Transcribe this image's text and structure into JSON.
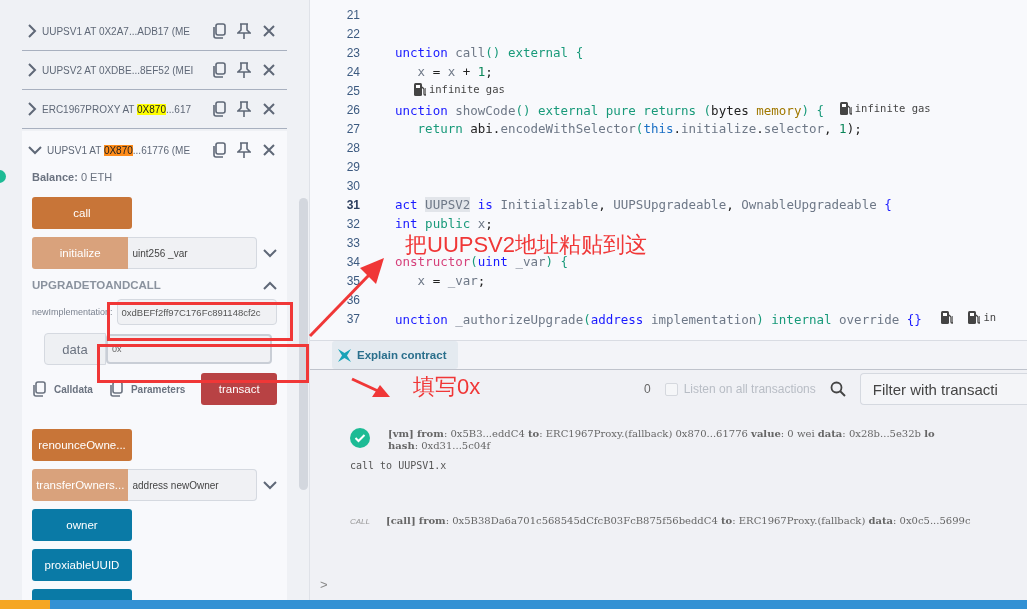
{
  "instances": [
    {
      "expanded": false,
      "title_parts": [
        {
          "text": "UUPSV1 AT 0X2A7...ADB17 (ME"
        }
      ]
    },
    {
      "expanded": false,
      "title_parts": [
        {
          "text": "UUPSV2 AT 0XDBE...8EF52 (MEI"
        }
      ]
    },
    {
      "expanded": false,
      "title_parts": [
        {
          "text": "ERC1967PROXY AT "
        },
        {
          "text": "0X870",
          "color": "#ffff00"
        },
        {
          "text": "...617"
        }
      ]
    },
    {
      "expanded": true,
      "title_parts": [
        {
          "text": "UUPSV1 AT "
        },
        {
          "text": "0X870",
          "color": "#ff8c1a"
        },
        {
          "text": "...61776 (ME"
        }
      ]
    }
  ],
  "balance": {
    "label": "Balance:",
    "value": "0 ETH"
  },
  "functions": [
    {
      "kind": "button",
      "label": "call",
      "color": "#c87538"
    },
    {
      "kind": "input",
      "label": "initialize",
      "placeholder": "uint256 _var",
      "color": "#d9a27c"
    },
    {
      "kind": "expanded",
      "title": "UPGRADETOANDCALL",
      "param_label": "newImplementation:",
      "param_value": "0xdBEFf2ff97C176Fc891148cf2c",
      "data_label": "data",
      "data_value": "0x",
      "calldata": "Calldata",
      "parameters": "Parameters",
      "transact": "transact",
      "color": "#b84244"
    },
    {
      "kind": "button",
      "label": "renounceOwne...",
      "color": "#c87538"
    },
    {
      "kind": "input",
      "label": "transferOwners...",
      "placeholder": "address newOwner",
      "color": "#d9a27c"
    },
    {
      "kind": "button",
      "label": "owner",
      "color": "#0a7aa6"
    },
    {
      "kind": "button",
      "label": "proxiableUUID",
      "color": "#0a7aa6"
    },
    {
      "kind": "stub",
      "color": "#0a7aa6"
    }
  ],
  "code_lines": [
    {
      "number": "21",
      "current": false
    },
    {
      "number": "22",
      "current": false
    },
    {
      "number": "23",
      "current": false,
      "tokens": [
        {
          "kind": "kw",
          "text": "unction "
        },
        {
          "kind": "fn",
          "text": "call"
        },
        {
          "kind": "mod",
          "text": "() external {"
        }
      ]
    },
    {
      "number": "24",
      "current": false,
      "tokens": [
        {
          "kind": "fn",
          "text": "   x "
        },
        {
          "kind": "plain",
          "text": "= "
        },
        {
          "kind": "fn",
          "text": "x "
        },
        {
          "kind": "plain",
          "text": "+ "
        },
        {
          "kind": "num",
          "text": "1"
        },
        {
          "kind": "plain",
          "text": ";"
        }
      ]
    },
    {
      "number": "25",
      "current": false,
      "tokens": [
        {
          "kind": "gas",
          "text": "infinite gas"
        }
      ]
    },
    {
      "number": "26",
      "current": false,
      "tokens": [
        {
          "kind": "kw",
          "text": "unction "
        },
        {
          "kind": "fn",
          "text": "showCode"
        },
        {
          "kind": "mod",
          "text": "() external pure returns ("
        },
        {
          "kind": "plain",
          "text": "bytes "
        },
        {
          "kind": "type",
          "text": "memory"
        },
        {
          "kind": "mod",
          "text": ") {"
        },
        {
          "kind": "gas",
          "text": "infinite gas"
        }
      ]
    },
    {
      "number": "27",
      "current": false,
      "tokens": [
        {
          "kind": "mod",
          "text": "   return "
        },
        {
          "kind": "plain",
          "text": "abi."
        },
        {
          "kind": "fn",
          "text": "encodeWithSelector"
        },
        {
          "kind": "mod",
          "text": "("
        },
        {
          "kind": "this",
          "text": "this"
        },
        {
          "kind": "plain",
          "text": "."
        },
        {
          "kind": "fn",
          "text": "initialize"
        },
        {
          "kind": "plain",
          "text": "."
        },
        {
          "kind": "fn",
          "text": "selector"
        },
        {
          "kind": "plain",
          "text": ", "
        },
        {
          "kind": "num",
          "text": "1"
        },
        {
          "kind": "plain",
          "text": ");"
        }
      ]
    },
    {
      "number": "28",
      "current": false
    },
    {
      "number": "29",
      "current": false
    },
    {
      "number": "30",
      "current": false
    },
    {
      "number": "31",
      "current": true,
      "tokens": [
        {
          "kind": "kw",
          "text": "act "
        },
        {
          "kind": "hl",
          "text": "UUPSV2"
        },
        {
          "kind": "kw",
          "text": " is "
        },
        {
          "kind": "fn",
          "text": "Initializable"
        },
        {
          "kind": "plain",
          "text": ", "
        },
        {
          "kind": "fn",
          "text": "UUPSUpgradeable"
        },
        {
          "kind": "plain",
          "text": ", "
        },
        {
          "kind": "fn",
          "text": "OwnableUpgradeable"
        },
        {
          "kind": "kw",
          "text": " {"
        }
      ]
    },
    {
      "number": "32",
      "current": false,
      "tokens": [
        {
          "kind": "kw",
          "text": "int "
        },
        {
          "kind": "mod",
          "text": "public "
        },
        {
          "kind": "fn",
          "text": "x"
        },
        {
          "kind": "plain",
          "text": ";"
        }
      ]
    },
    {
      "number": "33",
      "current": false
    },
    {
      "number": "34",
      "current": false,
      "tokens": [
        {
          "kind": "ctor",
          "text": "onstructor"
        },
        {
          "kind": "mod",
          "text": "("
        },
        {
          "kind": "kw",
          "text": "uint "
        },
        {
          "kind": "fn",
          "text": "_var"
        },
        {
          "kind": "mod",
          "text": ") {"
        }
      ]
    },
    {
      "number": "35",
      "current": false,
      "tokens": [
        {
          "kind": "fn",
          "text": "   x "
        },
        {
          "kind": "plain",
          "text": "= "
        },
        {
          "kind": "fn",
          "text": "_var"
        },
        {
          "kind": "plain",
          "text": ";"
        }
      ]
    },
    {
      "number": "36",
      "current": false
    },
    {
      "number": "37",
      "current": false,
      "tokens": [
        {
          "kind": "kw",
          "text": "unction "
        },
        {
          "kind": "fn",
          "text": "_authorizeUpgrade"
        },
        {
          "kind": "mod",
          "text": "("
        },
        {
          "kind": "kw",
          "text": "address "
        },
        {
          "kind": "fn",
          "text": "implementation"
        },
        {
          "kind": "mod",
          "text": ") internal "
        },
        {
          "kind": "fn",
          "text": "override "
        },
        {
          "kind": "kw",
          "text": "{}"
        },
        {
          "kind": "gasicon"
        },
        {
          "kind": "gas",
          "text": "in"
        }
      ]
    }
  ],
  "explain": {
    "label": "Explain contract"
  },
  "terminal": {
    "count": "0",
    "listen": {
      "label": "Listen on all transactions",
      "checked": false
    },
    "filter_placeholder": "Filter with transacti",
    "entries": [
      {
        "kind": "success",
        "lines": [
          "**[vm]** **from**: 0x5B3...eddC4 **to**: ERC1967Proxy.(fallback) 0x870...61776 **value**: 0 wei **data**: 0x28b...5e32b **lo**",
          "**hash**: 0xd31...5c04f"
        ],
        "note": "call to UUPSV1.x"
      },
      {
        "kind": "call",
        "badge": "CALL",
        "lines": [
          "**[call]** **from**: 0x5B38Da6a701c568545dCfcB03FcB875f56beddC4 **to**: ERC1967Proxy.(fallback) **data**: 0x0c5...5699c"
        ]
      }
    ],
    "prompt": ">"
  },
  "annotations": [
    {
      "kind": "label",
      "text": "把UUPSV2地址粘贴到这"
    },
    {
      "kind": "label",
      "text": "填写0x"
    }
  ]
}
